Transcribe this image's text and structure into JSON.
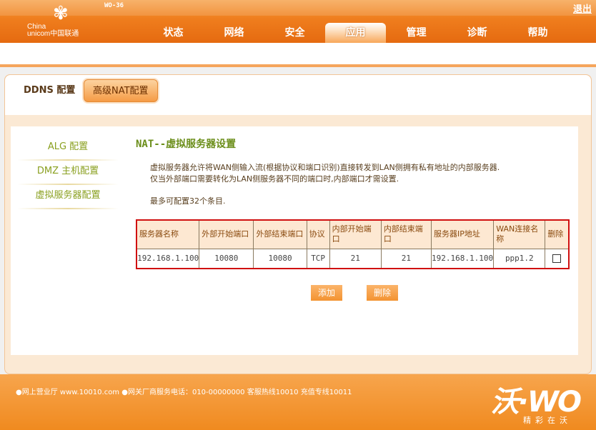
{
  "header": {
    "brand_line1": "China",
    "brand_line2": "unicom中国联通",
    "model": "WO-36",
    "logout": "退出",
    "nav": [
      "状态",
      "网络",
      "安全",
      "应用",
      "管理",
      "诊断",
      "帮助"
    ],
    "active_nav": "应用"
  },
  "tabs": {
    "ddns": "DDNS 配置",
    "nat": "高级NAT配置"
  },
  "sidebar": {
    "items": [
      "ALG 配置",
      "DMZ 主机配置",
      "虚拟服务器配置"
    ]
  },
  "main": {
    "title": "NAT--虚拟服务器设置",
    "desc_line1": "虚拟服务器允许将WAN侧输入流(根据协议和端口识别)直接转发到LAN侧拥有私有地址的内部服务器.",
    "desc_line2": "仅当外部端口需要转化为LAN侧服务器不同的端口时,内部端口才需设置.",
    "max_entries": "最多可配置32个条目."
  },
  "table": {
    "headers": [
      "服务器名称",
      "外部开始端口",
      "外部结束端口",
      "协议",
      "内部开始端口",
      "内部结束端口",
      "服务器IP地址",
      "WAN连接名称",
      "删除"
    ],
    "rows": [
      [
        "192.168.1.100",
        "10080",
        "10080",
        "TCP",
        "21",
        "21",
        "192.168.1.100",
        "ppp1.2"
      ]
    ]
  },
  "buttons": {
    "add": "添加",
    "delete": "删除"
  },
  "footer": {
    "links": "●网上营业厅 www.10010.com ●网关厂商服务电话：010-00000000   客服热线10010  充值专线10011",
    "slogan": "精彩在沃"
  }
}
